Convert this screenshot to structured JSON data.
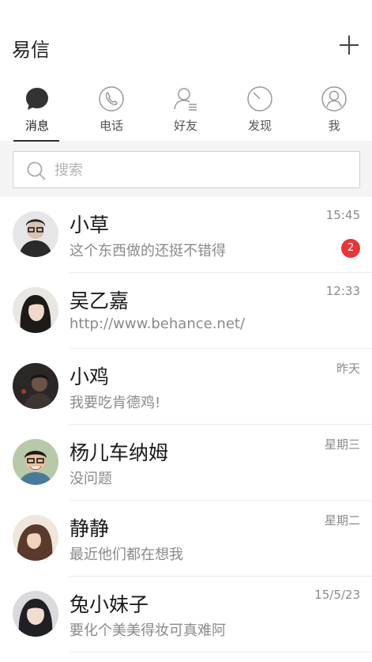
{
  "header": {
    "title": "易信",
    "add_icon": "plus-icon"
  },
  "tabs": [
    {
      "label": "消息",
      "icon": "chat-bubble-icon",
      "active": true
    },
    {
      "label": "电话",
      "icon": "phone-icon",
      "active": false
    },
    {
      "label": "好友",
      "icon": "contacts-icon",
      "active": false
    },
    {
      "label": "发现",
      "icon": "compass-icon",
      "active": false
    },
    {
      "label": "我",
      "icon": "profile-icon",
      "active": false
    }
  ],
  "search": {
    "placeholder": "搜索",
    "icon": "search-icon"
  },
  "conversations": [
    {
      "name": "小草",
      "preview": "这个东西做的还挺不错得",
      "time": "15:45",
      "unread": "2",
      "avatar_color": "#3a3a3a"
    },
    {
      "name": "吴乙嘉",
      "preview": "http://www.behance.net/",
      "time": "12:33",
      "unread": "",
      "avatar_color": "#5a4a44"
    },
    {
      "name": "小鸡",
      "preview": "我要吃肯德鸡!",
      "time": "昨天",
      "unread": "",
      "avatar_color": "#2e2b2a"
    },
    {
      "name": "杨儿车纳姆",
      "preview": "没问题",
      "time": "星期三",
      "unread": "",
      "avatar_color": "#7a8a6a"
    },
    {
      "name": "静静",
      "preview": "最近他们都在想我",
      "time": "星期二",
      "unread": "",
      "avatar_color": "#6b4a3a"
    },
    {
      "name": "兔小妹子",
      "preview": "要化个美美得妆可真难阿",
      "time": "15/5/23",
      "unread": "",
      "avatar_color": "#4a4a55"
    }
  ],
  "colors": {
    "badge": "#e8353a",
    "accent": "#333333"
  }
}
